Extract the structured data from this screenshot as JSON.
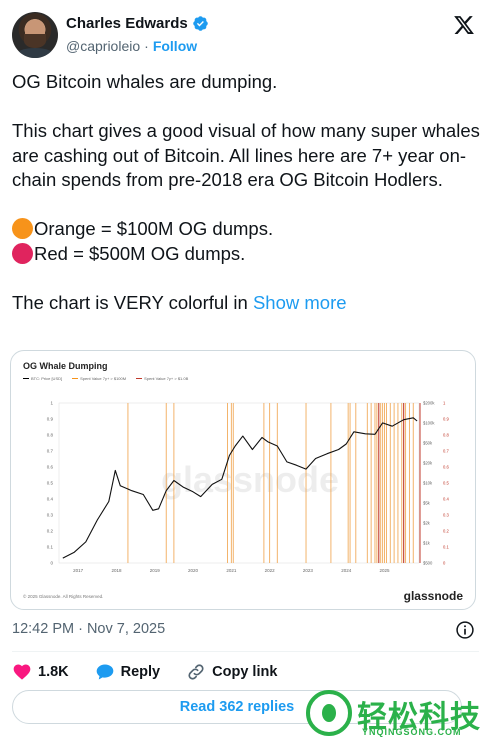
{
  "author": {
    "name": "Charles Edwards",
    "handle": "@caprioleio",
    "separator": "·",
    "follow_label": "Follow"
  },
  "tweet": {
    "lines": [
      "OG Bitcoin whales are dumping.",
      "This chart gives a good visual of how many super whales are cashing out of Bitcoin. All lines here are 7+ year on-chain spends from pre-2018 era OG Bitcoin Hodlers.",
      "Orange = $100M OG dumps.",
      "Red = $500M OG dumps.",
      "The chart is VERY colorful in"
    ],
    "show_more": "Show more",
    "orange_color": "#f7931a",
    "red_color": "#e0245e"
  },
  "media": {
    "title": "OG Whale Dumping",
    "legend": [
      "BTC: Price [USD]",
      "Spent Value 7y+ > $100M",
      "Spent Value 7y+ > $1.0B"
    ],
    "watermark": "glassnode",
    "copyright": "© 2025 Glassnode. All Rights Reserved.",
    "brand": "glassnode",
    "chart_data": {
      "type": "line",
      "title": "OG Whale Dumping",
      "x_ticks": [
        "2017",
        "2018",
        "2019",
        "2020",
        "2021",
        "2022",
        "2023",
        "2024",
        "2025"
      ],
      "y_left_ticks": [
        "0",
        "0.1",
        "0.2",
        "0.3",
        "0.4",
        "0.5",
        "0.6",
        "0.7",
        "0.8",
        "0.9",
        "1"
      ],
      "y_right_ticks": [
        "$500",
        "$1k",
        "$2k",
        "$5k",
        "$10k",
        "$20k",
        "$50k",
        "$100k",
        "$200k"
      ],
      "y_right2_ticks": [
        "0",
        "0.1",
        "0.2",
        "0.3",
        "0.4",
        "0.5",
        "0.6",
        "0.7",
        "0.8",
        "0.9",
        "1"
      ],
      "price_series": {
        "name": "BTC: Price [USD]",
        "x": [
          2016.6,
          2016.9,
          2017.2,
          2017.5,
          2017.8,
          2017.97,
          2018.1,
          2018.4,
          2018.7,
          2018.95,
          2019.1,
          2019.3,
          2019.5,
          2019.75,
          2020.0,
          2020.2,
          2020.5,
          2020.75,
          2020.95,
          2021.1,
          2021.3,
          2021.55,
          2021.8,
          2021.95,
          2022.2,
          2022.45,
          2022.7,
          2022.95,
          2023.2,
          2023.5,
          2023.8,
          2024.0,
          2024.2,
          2024.5,
          2024.75,
          2024.95,
          2025.2,
          2025.5,
          2025.75,
          2025.85
        ],
        "y": [
          600,
          750,
          1100,
          2500,
          5000,
          16000,
          9000,
          7500,
          6500,
          3600,
          3800,
          7500,
          11000,
          8500,
          7200,
          6000,
          9500,
          11500,
          28000,
          40000,
          58000,
          35000,
          55000,
          47000,
          40000,
          22000,
          19500,
          16800,
          25000,
          30000,
          35000,
          43000,
          68000,
          63000,
          62000,
          95000,
          84000,
          107000,
          115000,
          102000
        ]
      },
      "orange_spend_dates": [
        2018.3,
        2019.3,
        2019.5,
        2020.9,
        2021.0,
        2021.05,
        2021.85,
        2022.0,
        2022.2,
        2022.95,
        2023.6,
        2024.05,
        2024.1,
        2024.25,
        2024.55,
        2024.65,
        2024.75,
        2024.8,
        2024.9,
        2024.95,
        2025.0,
        2025.05,
        2025.15,
        2025.25,
        2025.35,
        2025.45,
        2025.55,
        2025.65,
        2025.75
      ],
      "red_spend_dates": [
        2024.85,
        2025.5
      ]
    }
  },
  "meta": {
    "timestamp": "12:42 PM · Nov 7, 2025"
  },
  "actions": {
    "likes": "1.8K",
    "reply": "Reply",
    "copy_link": "Copy link",
    "read_replies": "Read 362 replies"
  },
  "site_watermark": {
    "chinese": "轻松科技",
    "english": "YNQINGSONG.COM",
    "color": "#2bb14a"
  }
}
